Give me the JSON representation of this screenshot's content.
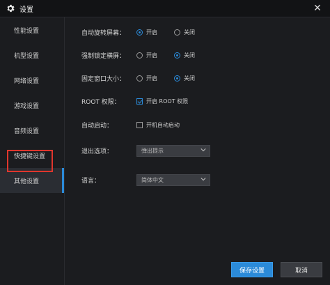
{
  "window": {
    "title": "设置"
  },
  "sidebar": {
    "items": [
      {
        "label": "性能设置"
      },
      {
        "label": "机型设置"
      },
      {
        "label": "网络设置"
      },
      {
        "label": "游戏设置"
      },
      {
        "label": "音频设置"
      },
      {
        "label": "快捷键设置"
      },
      {
        "label": "其他设置",
        "active": true
      }
    ]
  },
  "settings": {
    "auto_rotate": {
      "label": "自动旋转屏幕：",
      "on": "开启",
      "off": "关闭",
      "selected": "on"
    },
    "force_landscape": {
      "label": "强制锁定横屏：",
      "on": "开启",
      "off": "关闭",
      "selected": "off"
    },
    "fixed_window": {
      "label": "固定窗口大小：",
      "on": "开启",
      "off": "关闭",
      "selected": "off"
    },
    "root": {
      "label": "ROOT 权限：",
      "checkbox_label": "开启 ROOT 权限",
      "checked": true
    },
    "autostart": {
      "label": "自动启动：",
      "checkbox_label": "开机自动启动",
      "checked": false
    },
    "exit_option": {
      "label": "退出选项：",
      "value": "弹出提示"
    },
    "language": {
      "label": "语言：",
      "value": "简体中文"
    }
  },
  "footer": {
    "save": "保存设置",
    "cancel": "取消"
  },
  "colors": {
    "accent": "#2b8ad8",
    "highlight": "#e0362d",
    "background": "#1b1c1f"
  },
  "icons": {
    "title": "gear-icon",
    "close": "close-icon",
    "dropdown": "chevron-down-icon"
  }
}
